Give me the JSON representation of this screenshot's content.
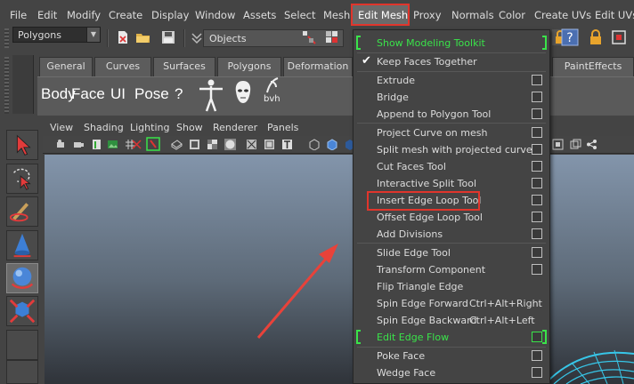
{
  "menubar": {
    "items": [
      "File",
      "Edit",
      "Modify",
      "Create",
      "Display",
      "Window",
      "Assets",
      "Select",
      "Mesh",
      "Edit Mesh",
      "Proxy",
      "Normals",
      "Color",
      "Create UVs",
      "Edit UVs"
    ]
  },
  "statusline": {
    "mode": "Polygons",
    "selection_mode": "Objects"
  },
  "shelf": {
    "tabs": [
      "General",
      "Curves",
      "Surfaces",
      "Polygons",
      "Deformation",
      "PaintEffects"
    ],
    "buttons": [
      "Body",
      "Face",
      "UI",
      "Pose",
      "?"
    ],
    "bvh_label": "bvh"
  },
  "viewport": {
    "menu": [
      "View",
      "Shading",
      "Lighting",
      "Show",
      "Renderer",
      "Panels"
    ]
  },
  "edit_mesh_menu": {
    "items": [
      {
        "label": "Show Modeling Toolkit"
      },
      {
        "label": "Keep Faces Together"
      },
      {
        "label": "Extrude"
      },
      {
        "label": "Bridge"
      },
      {
        "label": "Append to Polygon Tool"
      },
      {
        "label": "Project Curve on mesh"
      },
      {
        "label": "Split mesh with projected curve"
      },
      {
        "label": "Cut Faces Tool"
      },
      {
        "label": "Interactive Split Tool"
      },
      {
        "label": "Insert Edge Loop Tool"
      },
      {
        "label": "Offset Edge Loop Tool"
      },
      {
        "label": "Add Divisions"
      },
      {
        "label": "Slide Edge Tool"
      },
      {
        "label": "Transform Component"
      },
      {
        "label": "Flip Triangle Edge"
      },
      {
        "label": "Spin Edge Forward",
        "shortcut": "Ctrl+Alt+Right"
      },
      {
        "label": "Spin Edge Backward",
        "shortcut": "Ctrl+Alt+Left"
      },
      {
        "label": "Edit Edge Flow"
      },
      {
        "label": "Poke Face"
      },
      {
        "label": "Wedge Face"
      }
    ]
  },
  "colors": {
    "highlight": "#e0352c",
    "toolkit_green": "#3ae34a",
    "ui_bg": "#444444"
  }
}
